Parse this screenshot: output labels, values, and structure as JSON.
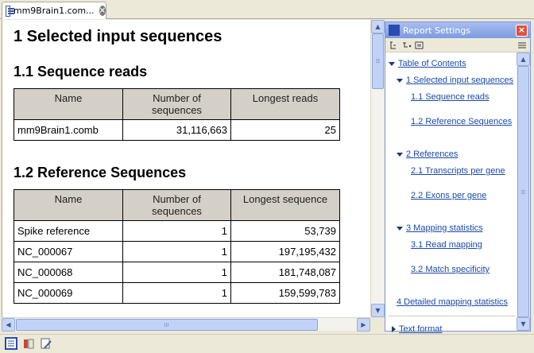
{
  "tab": {
    "label": "mm9Brain1.com...",
    "close_icon": "close-icon"
  },
  "report": {
    "h1": "1 Selected input sequences",
    "section1": {
      "title": "1.1 Sequence reads",
      "headers": [
        "Name",
        "Number of\nsequences",
        "Longest reads"
      ],
      "rows": [
        [
          "mm9Brain1.comb",
          "31,116,663",
          "25"
        ]
      ]
    },
    "section2": {
      "title": "1.2 Reference Sequences",
      "headers": [
        "Name",
        "Number of\nsequences",
        "Longest sequence"
      ],
      "rows": [
        [
          "Spike reference",
          "1",
          "53,739"
        ],
        [
          "NC_000067",
          "1",
          "197,195,432"
        ],
        [
          "NC_000068",
          "1",
          "181,748,087"
        ],
        [
          "NC_000069",
          "1",
          "159,599,783"
        ]
      ]
    }
  },
  "settings": {
    "title": "Report Settings",
    "tree": {
      "toc": "Table of Contents",
      "s1": "1 Selected input sequences",
      "s1_1": "1.1 Sequence reads",
      "s1_2": "1.2 Reference Sequences",
      "s2": "2 References",
      "s2_1": "2.1 Transcripts per gene",
      "s2_2": "2.2 Exons per gene",
      "s3": "3 Mapping statistics",
      "s3_1": "3.1 Read mapping",
      "s3_2": "3.2 Match specificity",
      "s4": "4 Detailed mapping statistics",
      "text_format": "Text format"
    }
  },
  "colors": {
    "link": "#1a4aa8",
    "table_header": "#d4d0c8",
    "panel_title": "#7c9be0",
    "close": "#e2513a"
  }
}
